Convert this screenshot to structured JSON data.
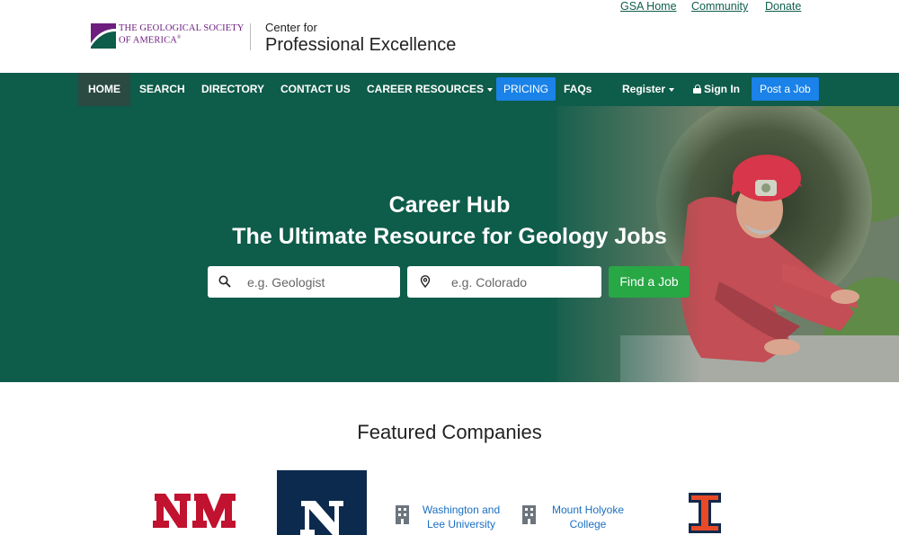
{
  "header": {
    "logo_line1": "THE GEOLOGICAL SOCIETY",
    "logo_line2": "OF AMERICA",
    "logo_reg": "®",
    "cpe_small": "Center for",
    "cpe_big": "Professional Excellence",
    "links": [
      "GSA Home",
      "Community",
      "Donate"
    ]
  },
  "nav": {
    "home": "HOME",
    "search": "SEARCH",
    "directory": "DIRECTORY",
    "contact": "CONTACT US",
    "career": "CAREER RESOURCES",
    "pricing": "PRICING",
    "faqs": "FAQs",
    "register": "Register",
    "signin": "Sign In",
    "post_job": "Post a Job"
  },
  "hero": {
    "title_line1": "Career Hub",
    "title_line2": "The Ultimate Resource for Geology Jobs",
    "keyword_placeholder": "e.g. Geologist",
    "location_placeholder": "e.g. Colorado",
    "find_button": "Find a Job"
  },
  "featured": {
    "title": "Featured Companies",
    "companies": [
      {
        "name": "University of New Mexico",
        "icon": "unm-logo"
      },
      {
        "name": "University of Nevada",
        "icon": "nevada-logo"
      },
      {
        "line1": "Washington and",
        "line2": "Lee University",
        "icon": "building-icon"
      },
      {
        "line1": "Mount Holyoke",
        "line2": "College",
        "icon": "building-icon"
      },
      {
        "name": "University of Illinois",
        "icon": "illinois-logo"
      }
    ]
  },
  "colors": {
    "brand_green": "#0e5c4a",
    "active_nav": "#2a4a42",
    "accent_blue": "#1a82e8",
    "find_green": "#28a745",
    "link_green": "#0f5e4c",
    "logo_purple": "#6d1e7f"
  }
}
